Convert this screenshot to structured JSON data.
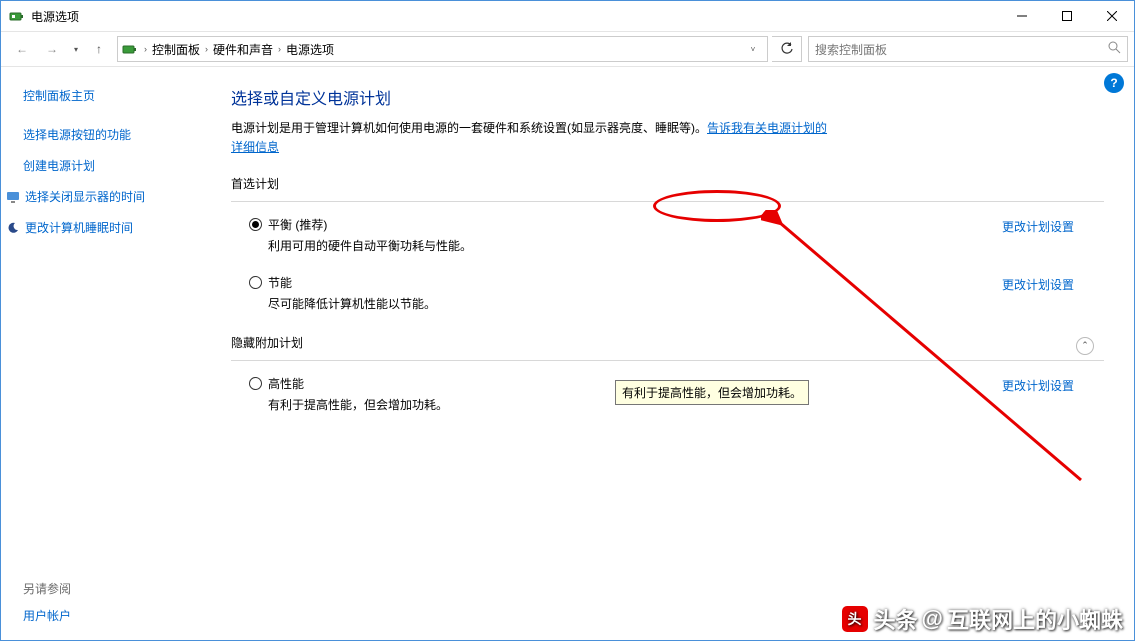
{
  "window": {
    "title": "电源选项"
  },
  "nav": {
    "breadcrumbs": [
      "控制面板",
      "硬件和声音",
      "电源选项"
    ],
    "search_placeholder": "搜索控制面板"
  },
  "sidebar": {
    "home": "控制面板主页",
    "links": [
      {
        "label": "选择电源按钮的功能",
        "icon": null
      },
      {
        "label": "创建电源计划",
        "icon": null
      },
      {
        "label": "选择关闭显示器的时间",
        "icon": "monitor"
      },
      {
        "label": "更改计算机睡眠时间",
        "icon": "moon"
      }
    ],
    "see_also_heading": "另请参阅",
    "see_also": [
      "用户帐户"
    ]
  },
  "content": {
    "heading": "选择或自定义电源计划",
    "description_prefix": "电源计划是用于管理计算机如何使用电源的一套硬件和系统设置(如显示器亮度、睡眠等)。",
    "description_link": "告诉我有关电源计划的详细信息",
    "preferred_section": "首选计划",
    "hidden_section": "隐藏附加计划",
    "plans": [
      {
        "name": "平衡 (推荐)",
        "desc": "利用可用的硬件自动平衡功耗与性能。",
        "selected": true,
        "change": "更改计划设置"
      },
      {
        "name": "节能",
        "desc": "尽可能降低计算机性能以节能。",
        "selected": false,
        "change": "更改计划设置"
      }
    ],
    "hidden_plans": [
      {
        "name": "高性能",
        "desc": "有利于提高性能，但会增加功耗。",
        "selected": false,
        "change": "更改计划设置"
      }
    ],
    "tooltip": "有利于提高性能，但会增加功耗。"
  },
  "watermark": {
    "prefix": "头条",
    "at": "@",
    "name": "互联网上的小蜘蛛"
  }
}
